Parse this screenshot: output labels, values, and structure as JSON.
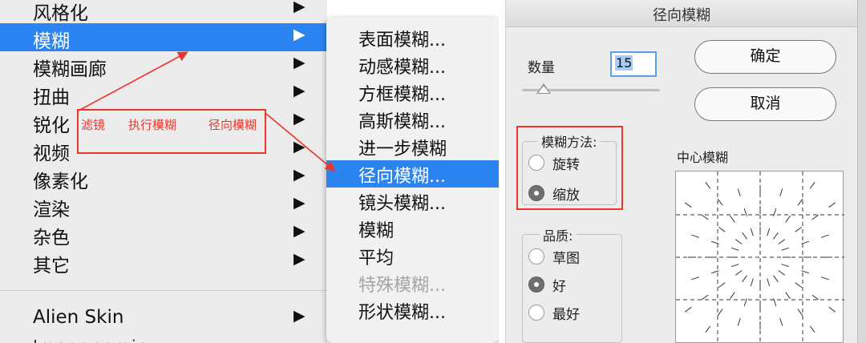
{
  "main_menu": {
    "items": [
      {
        "label": "风格化"
      },
      {
        "label": "模糊"
      },
      {
        "label": "模糊画廊"
      },
      {
        "label": "扭曲"
      },
      {
        "label": "锐化"
      },
      {
        "label": "视频"
      },
      {
        "label": "像素化"
      },
      {
        "label": "渲染"
      },
      {
        "label": "杂色"
      },
      {
        "label": "其它"
      }
    ],
    "plugin": "Alien Skin",
    "partial_item": "Imagenomic",
    "arrow": "▶"
  },
  "annotation": {
    "step1": "滤镜",
    "step2": "执行模糊",
    "step3": "径向模糊",
    "color": "#e9372c"
  },
  "submenu": {
    "items": [
      {
        "label": "表面模糊..."
      },
      {
        "label": "动感模糊..."
      },
      {
        "label": "方框模糊..."
      },
      {
        "label": "高斯模糊..."
      },
      {
        "label": "进一步模糊"
      },
      {
        "label": "径向模糊..."
      },
      {
        "label": "镜头模糊..."
      },
      {
        "label": "模糊"
      },
      {
        "label": "平均"
      },
      {
        "label": "特殊模糊..."
      },
      {
        "label": "形状模糊..."
      }
    ]
  },
  "dialog": {
    "title": "径向模糊",
    "amount_label": "数量",
    "amount_value": "15",
    "ok_label": "确定",
    "cancel_label": "取消",
    "method_title": "模糊方法:",
    "method_options": [
      "旋转",
      "缩放"
    ],
    "method_selected": "缩放",
    "quality_title": "品质:",
    "quality_options": [
      "草图",
      "好",
      "最好"
    ],
    "quality_selected": "好",
    "center_label": "中心模糊"
  },
  "colors": {
    "selection": "#2b84ef",
    "annotation": "#e9372c"
  }
}
